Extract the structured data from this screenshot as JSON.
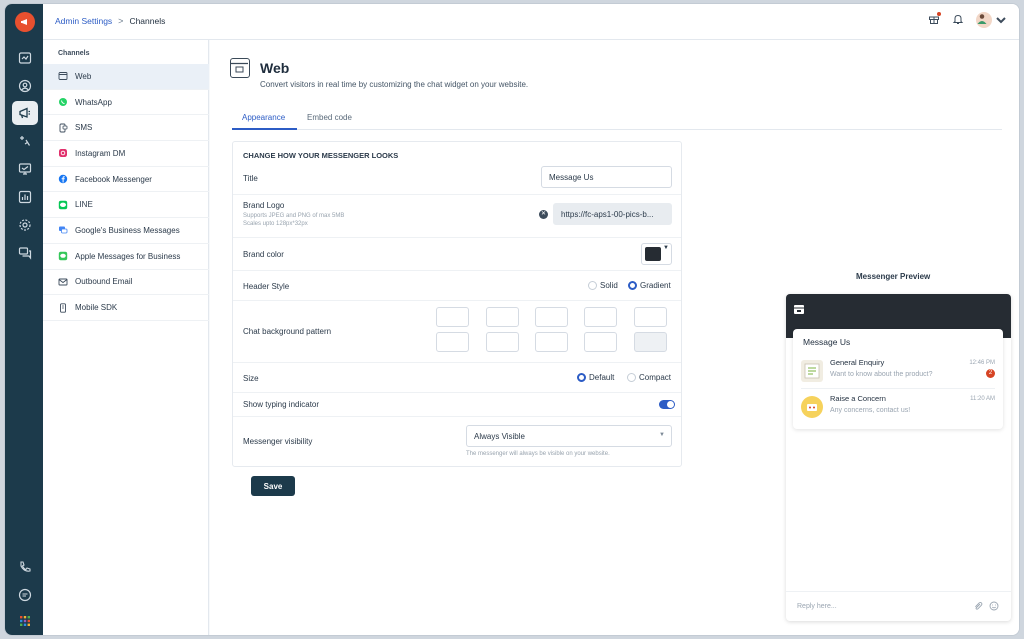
{
  "breadcrumb": {
    "parent": "Admin Settings",
    "separator": ">",
    "current": "Channels"
  },
  "sidebar": {
    "heading": "Channels",
    "items": [
      {
        "label": "Web",
        "icon": "web-widget-icon",
        "active": true
      },
      {
        "label": "WhatsApp",
        "icon": "whatsapp-icon"
      },
      {
        "label": "SMS",
        "icon": "sms-icon"
      },
      {
        "label": "Instagram DM",
        "icon": "instagram-icon"
      },
      {
        "label": "Facebook Messenger",
        "icon": "facebook-icon"
      },
      {
        "label": "LINE",
        "icon": "line-icon"
      },
      {
        "label": "Google's Business Messages",
        "icon": "google-business-icon"
      },
      {
        "label": "Apple Messages for Business",
        "icon": "apple-messages-icon"
      },
      {
        "label": "Outbound Email",
        "icon": "email-icon"
      },
      {
        "label": "Mobile SDK",
        "icon": "mobile-sdk-icon"
      }
    ]
  },
  "page": {
    "title": "Web",
    "subtitle": "Convert visitors in real time by customizing the chat widget on your website.",
    "tabs": [
      {
        "label": "Appearance",
        "active": true
      },
      {
        "label": "Embed code"
      }
    ]
  },
  "form": {
    "heading": "CHANGE HOW YOUR MESSENGER LOOKS",
    "title_label": "Title",
    "title_value": "Message Us",
    "brand_logo_label": "Brand Logo",
    "brand_logo_hint1": "Supports JPEG and PNG of max 5MB",
    "brand_logo_hint2": "Scales upto 128px*32px",
    "brand_logo_url": "https://fc-aps1-00-pics-b...",
    "brand_color_label": "Brand color",
    "brand_color": "#262c33",
    "header_style_label": "Header Style",
    "header_style_options": [
      "Solid",
      "Gradient"
    ],
    "header_style_selected": "Gradient",
    "bg_pattern_label": "Chat background pattern",
    "size_label": "Size",
    "size_options": [
      "Default",
      "Compact"
    ],
    "size_selected": "Default",
    "typing_label": "Show typing indicator",
    "typing_enabled": true,
    "visibility_label": "Messenger visibility",
    "visibility_value": "Always Visible",
    "visibility_hint": "The messenger will always be visible on your website.",
    "save_label": "Save"
  },
  "preview": {
    "heading": "Messenger Preview",
    "card_title": "Message Us",
    "conversations": [
      {
        "name": "General Enquiry",
        "message": "Want to know about the product?",
        "time": "12:46 PM",
        "unread": "2"
      },
      {
        "name": "Raise a Concern",
        "message": "Any concerns, contact us!",
        "time": "11:20 AM"
      }
    ],
    "reply_placeholder": "Reply here..."
  },
  "colors": {
    "rail": "#1c3a4b",
    "accent": "#2c5cc5",
    "brand": "#e8502f"
  }
}
